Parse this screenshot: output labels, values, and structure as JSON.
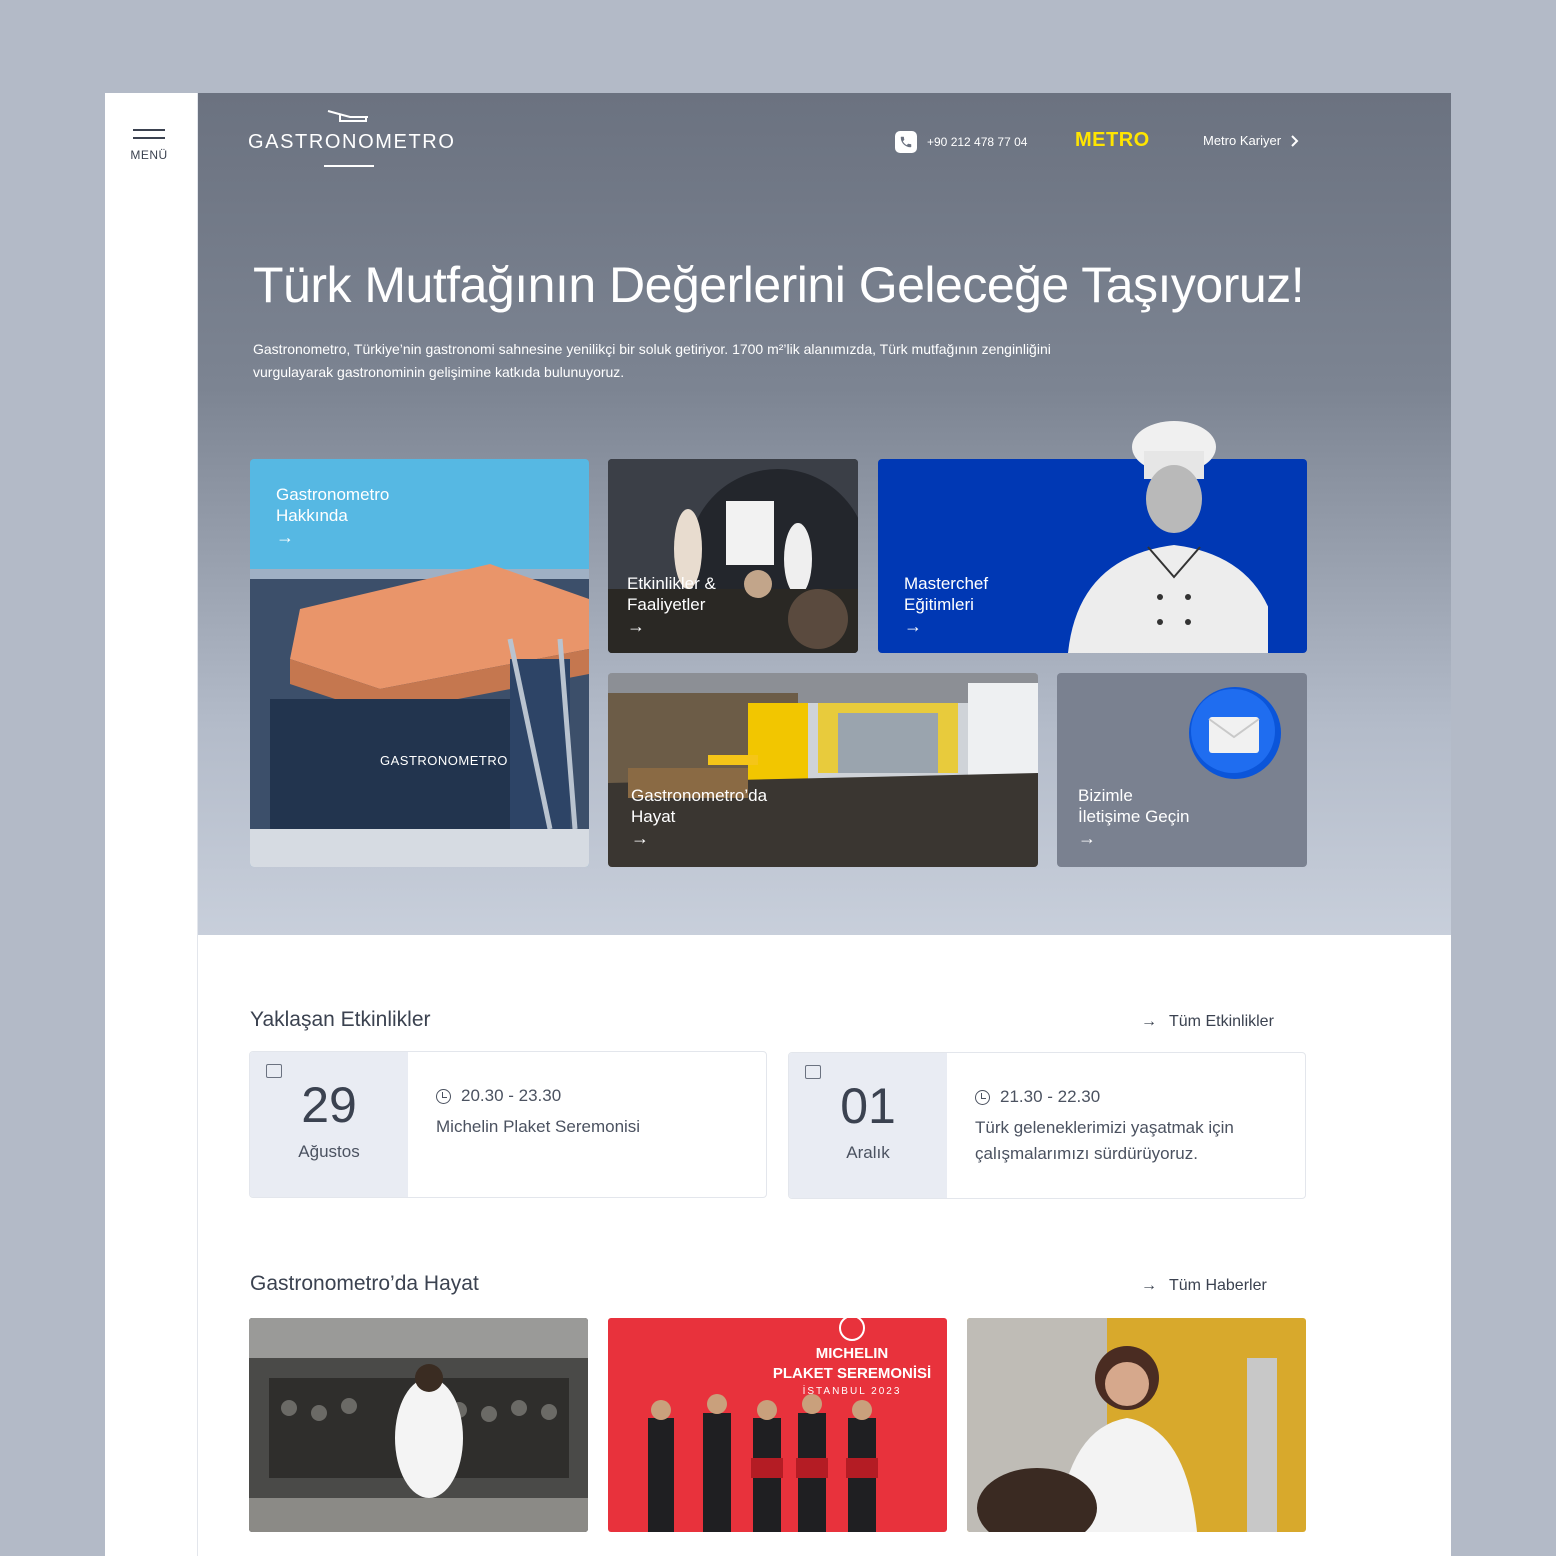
{
  "sidebar": {
    "menu_label": "MENÜ"
  },
  "header": {
    "logo_text": "GASTRONOMETRO",
    "phone": "+90 212 478 77 04",
    "metro_logo": "METRO",
    "career_link": "Metro Kariyer",
    "career_icon": "chevron-right-icon"
  },
  "hero": {
    "title": "Türk Mutfağının Değerlerini Geleceğe Taşıyoruz!",
    "intro": "Gastronometro, Türkiye’nin gastronomi sahnesine yenilikçi bir soluk getiriyor. 1700 m²’lik alanımızda, Türk mutfağının zenginliğini vurgulayarak gastronominin gelişimine katkıda bulunuyoruz."
  },
  "cards": [
    {
      "label": "Gastronometro\nHakkında",
      "arrow": "→",
      "building_sign": "GASTRONOMETRO"
    },
    {
      "label": "Etkinlikler &\nFaaliyetler",
      "arrow": "→"
    },
    {
      "label": "Masterchef\nEğitimleri",
      "arrow": "→"
    },
    {
      "label": "Gastronometro’da\nHayat",
      "arrow": "→"
    },
    {
      "label": "Bizimle\nİletişime Geçin",
      "arrow": "→"
    }
  ],
  "events": {
    "title": "Yaklaşan Etkinlikler",
    "all_link": "Tüm Etkinlikler",
    "items": [
      {
        "day": "29",
        "month": "Ağustos",
        "time": "20.30 - 23.30",
        "desc": "Michelin Plaket Seremonisi"
      },
      {
        "day": "01",
        "month": "Aralık",
        "time": "21.30 - 22.30",
        "desc": "Türk geleneklerimizi yaşatmak için çalışmalarımızı sürdürüyoruz."
      }
    ]
  },
  "life": {
    "title": "Gastronometro’da Hayat",
    "all_link": "Tüm Haberler",
    "news_images": [
      {
        "name": "chef-audience-photo"
      },
      {
        "name": "michelin-ceremony-photo",
        "banner_line1": "MICHELIN",
        "banner_line2": "PLAKET SEREMONİSİ",
        "banner_line3": "İSTANBUL 2023"
      },
      {
        "name": "speaker-woman-photo"
      }
    ]
  },
  "colors": {
    "accent_yellow": "#ffe500",
    "sky_blue": "#56b8e3",
    "royal_blue": "#0038b4",
    "ceremony_red": "#e8323c"
  }
}
